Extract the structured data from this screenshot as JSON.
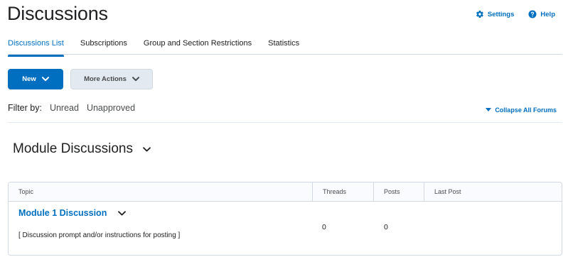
{
  "page": {
    "title": "Discussions"
  },
  "header": {
    "settings_label": "Settings",
    "help_label": "Help"
  },
  "tabs": [
    {
      "label": "Discussions List"
    },
    {
      "label": "Subscriptions"
    },
    {
      "label": "Group and Section Restrictions"
    },
    {
      "label": "Statistics"
    }
  ],
  "actions": {
    "new_label": "New",
    "more_label": "More Actions"
  },
  "filter": {
    "label": "Filter by:",
    "unread": "Unread",
    "unapproved": "Unapproved"
  },
  "collapse_all_label": "Collapse All Forums",
  "forum": {
    "title": "Module Discussions",
    "columns": [
      "Topic",
      "Threads",
      "Posts",
      "Last Post"
    ],
    "topics": [
      {
        "title": "Module 1 Discussion",
        "description": "[ Discussion prompt and/or instructions for posting ]",
        "threads": "0",
        "posts": "0",
        "last_post": ""
      }
    ]
  },
  "colors": {
    "accent": "#006fbf",
    "text": "#202122",
    "border": "#d3d9e3"
  }
}
